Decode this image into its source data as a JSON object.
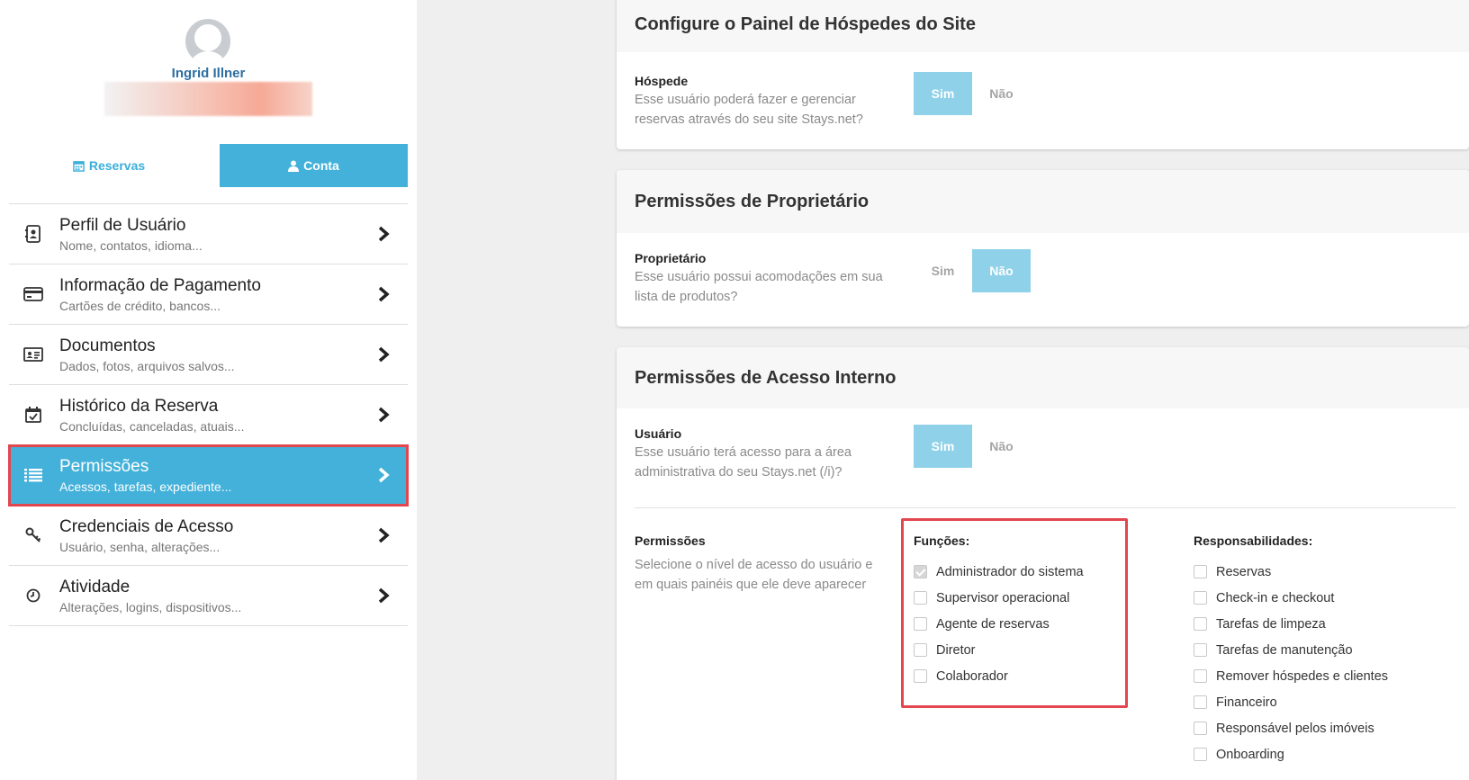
{
  "user": {
    "name": "Ingrid Illner"
  },
  "tabs": {
    "reservas": "Reservas",
    "conta": "Conta"
  },
  "menu": [
    {
      "title": "Perfil de Usuário",
      "sub": "Nome, contatos, idioma...",
      "icon": "contact-card-icon"
    },
    {
      "title": "Informação de Pagamento",
      "sub": "Cartões de crédito, bancos...",
      "icon": "credit-card-icon"
    },
    {
      "title": "Documentos",
      "sub": "Dados, fotos, arquivos salvos...",
      "icon": "id-card-icon"
    },
    {
      "title": "Histórico da Reserva",
      "sub": "Concluídas, canceladas, atuais...",
      "icon": "calendar-check-icon"
    },
    {
      "title": "Permissões",
      "sub": "Acessos, tarefas, expediente...",
      "icon": "list-icon"
    },
    {
      "title": "Credenciais de Acesso",
      "sub": "Usuário, senha, alterações...",
      "icon": "key-icon"
    },
    {
      "title": "Atividade",
      "sub": "Alterações, logins, dispositivos...",
      "icon": "clock-icon"
    }
  ],
  "site_panel": {
    "title": "Configure o Painel de Hóspedes do Site",
    "label": "Hóspede",
    "desc": "Esse usuário poderá fazer e gerenciar reservas através do seu site Stays.net?",
    "yes": "Sim",
    "no": "Não",
    "selected": "yes"
  },
  "owner": {
    "title": "Permissões de Proprietário",
    "label": "Proprietário",
    "desc": "Esse usuário possui acomodações em sua lista de produtos?",
    "yes": "Sim",
    "no": "Não",
    "selected": "no"
  },
  "internal": {
    "title": "Permissões de Acesso Interno",
    "label": "Usuário",
    "desc": "Esse usuário terá acesso para a área administrativa do seu Stays.net (/i)?",
    "yes": "Sim",
    "no": "Não",
    "selected": "yes",
    "perm_label": "Permissões",
    "perm_desc": "Selecione o nível de acesso do usuário e em quais painéis que ele deve aparecer",
    "functions_title": "Funções:",
    "functions": [
      {
        "label": "Administrador do sistema",
        "checked": true
      },
      {
        "label": "Supervisor operacional",
        "checked": false
      },
      {
        "label": "Agente de reservas",
        "checked": false
      },
      {
        "label": "Diretor",
        "checked": false
      },
      {
        "label": "Colaborador",
        "checked": false
      }
    ],
    "resp_title": "Responsabilidades:",
    "responsibilities": [
      {
        "label": "Reservas",
        "checked": false
      },
      {
        "label": "Check-in e checkout",
        "checked": false
      },
      {
        "label": "Tarefas de limpeza",
        "checked": false
      },
      {
        "label": "Tarefas de manutenção",
        "checked": false
      },
      {
        "label": "Remover hóspedes e clientes",
        "checked": false
      },
      {
        "label": "Financeiro",
        "checked": false
      },
      {
        "label": "Responsável pelos imóveis",
        "checked": false
      },
      {
        "label": "Onboarding",
        "checked": false
      }
    ]
  }
}
